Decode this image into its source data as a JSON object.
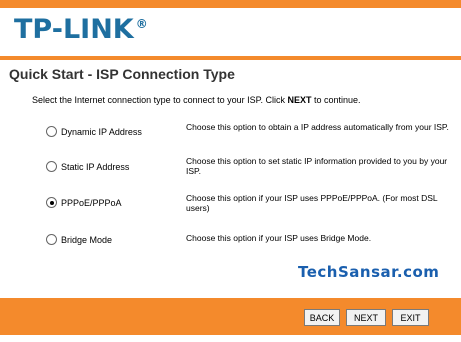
{
  "header": {
    "logo_text": "TP-LINK",
    "logo_mark": "®"
  },
  "page": {
    "title": "Quick Start - ISP Connection Type",
    "instructions_before": "Select the Internet connection type to connect to your ISP. Click ",
    "instructions_bold": "NEXT",
    "instructions_after": " to continue."
  },
  "options": [
    {
      "label": "Dynamic IP Address",
      "selected": false,
      "description": "Choose this option to obtain a IP address automatically from your ISP."
    },
    {
      "label": "Static IP Address",
      "selected": false,
      "description": "Choose this option to set static IP information provided to you by your ISP."
    },
    {
      "label": "PPPoE/PPPoA",
      "selected": true,
      "description": "Choose this option if your ISP uses PPPoE/PPPoA. (For most DSL users)"
    },
    {
      "label": "Bridge Mode",
      "selected": false,
      "description": "Choose this option if your ISP uses Bridge Mode."
    }
  ],
  "watermark": "TechSansar.com",
  "buttons": {
    "back": "BACK",
    "next": "NEXT",
    "exit": "EXIT"
  },
  "colors": {
    "accent": "#f48a2c",
    "logo": "#1e6fa0",
    "watermark": "#1a5fae"
  }
}
